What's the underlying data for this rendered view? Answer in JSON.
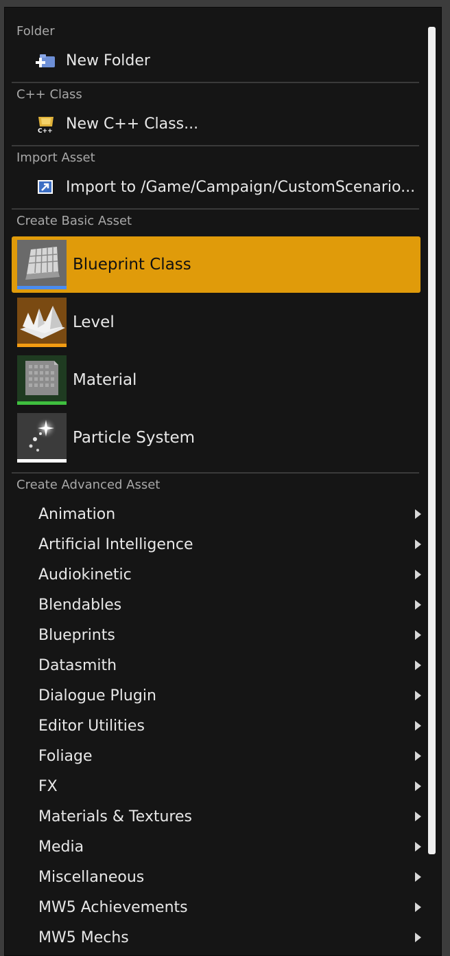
{
  "sections": {
    "folder": {
      "header": "Folder",
      "item": "New Folder"
    },
    "cpp": {
      "header": "C++ Class",
      "item": "New C++ Class..."
    },
    "import": {
      "header": "Import Asset",
      "item": "Import to /Game/Campaign/CustomScenario..."
    },
    "basic": {
      "header": "Create Basic Asset",
      "items": [
        {
          "label": "Blueprint Class",
          "icon": "blueprint-class-icon",
          "accent": "#4a8cf0",
          "selected": true
        },
        {
          "label": "Level",
          "icon": "level-icon",
          "accent": "#f39c12",
          "selected": false
        },
        {
          "label": "Material",
          "icon": "material-icon",
          "accent": "#3fbf3f",
          "selected": false
        },
        {
          "label": "Particle System",
          "icon": "particle-system-icon",
          "accent": "#ffffff",
          "selected": false
        }
      ]
    },
    "advanced": {
      "header": "Create Advanced Asset",
      "items": [
        "Animation",
        "Artificial Intelligence",
        "Audiokinetic",
        "Blendables",
        "Blueprints",
        "Datasmith",
        "Dialogue Plugin",
        "Editor Utilities",
        "Foliage",
        "FX",
        "Materials & Textures",
        "Media",
        "Miscellaneous",
        "MW5 Achievements",
        "MW5 Mechs"
      ]
    }
  },
  "colors": {
    "selection": "#e09b0a",
    "background": "#151515"
  }
}
